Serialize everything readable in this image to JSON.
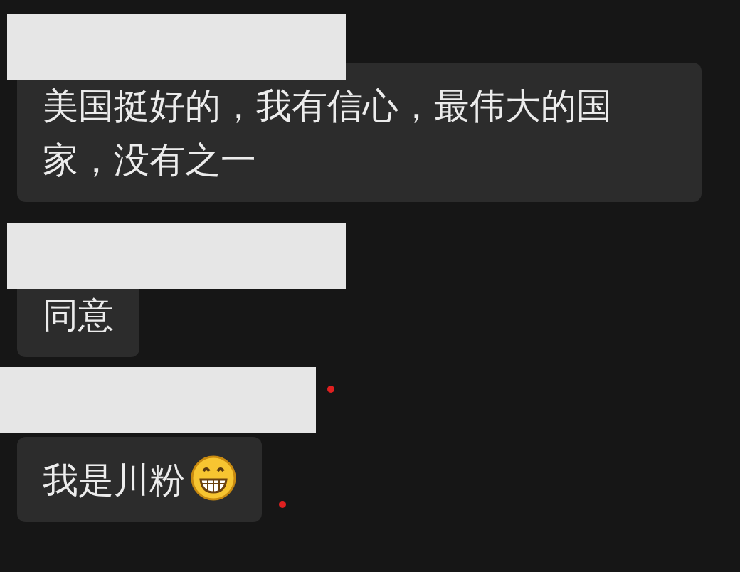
{
  "messages": [
    {
      "text": "美国挺好的，我有信心，最伟大的国家，没有之一"
    },
    {
      "text": "同意"
    },
    {
      "text": "我是川粉",
      "name_dot": true,
      "bubble_dot": true,
      "emoji": true
    }
  ]
}
